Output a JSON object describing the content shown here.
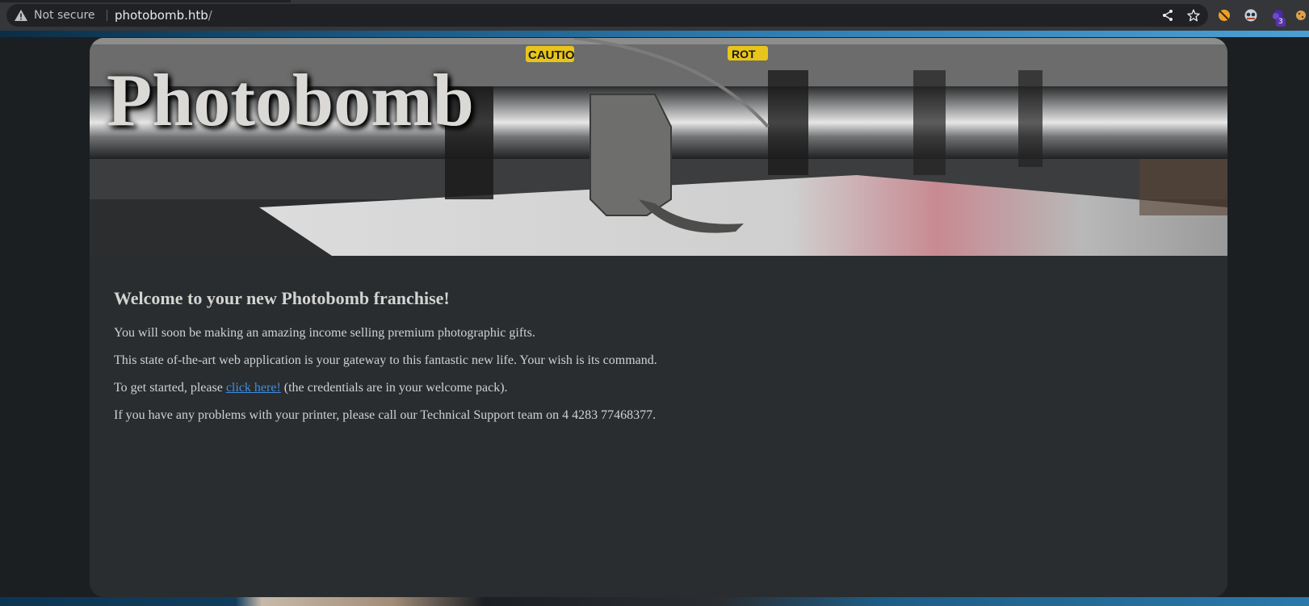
{
  "browser": {
    "security_label": "Not secure",
    "url_host": "photobomb.htb",
    "url_path": "/",
    "extension_badge": "3"
  },
  "hero": {
    "title": "Photobomb",
    "sign_caution": "CAUTIO",
    "sign_rot": "ROT"
  },
  "content": {
    "heading": "Welcome to your new Photobomb franchise!",
    "paragraph1": "You will soon be making an amazing income selling premium photographic gifts.",
    "paragraph2": "This state of-the-art web application is your gateway to this fantastic new life. Your wish is its command.",
    "paragraph3_before": "To get started, please ",
    "paragraph3_link": "click here!",
    "paragraph3_after": " (the credentials are in your welcome pack).",
    "paragraph4": "If you have any problems with your printer, please call our Technical Support team on 4 4283 77468377."
  },
  "colors": {
    "card_bg": "#292d30",
    "link": "#3f8edc",
    "text": "#cfd2d3",
    "caution_yellow": "#e8c51a"
  },
  "icons": [
    "warning-icon",
    "share-icon",
    "star-icon",
    "extension-icon"
  ]
}
